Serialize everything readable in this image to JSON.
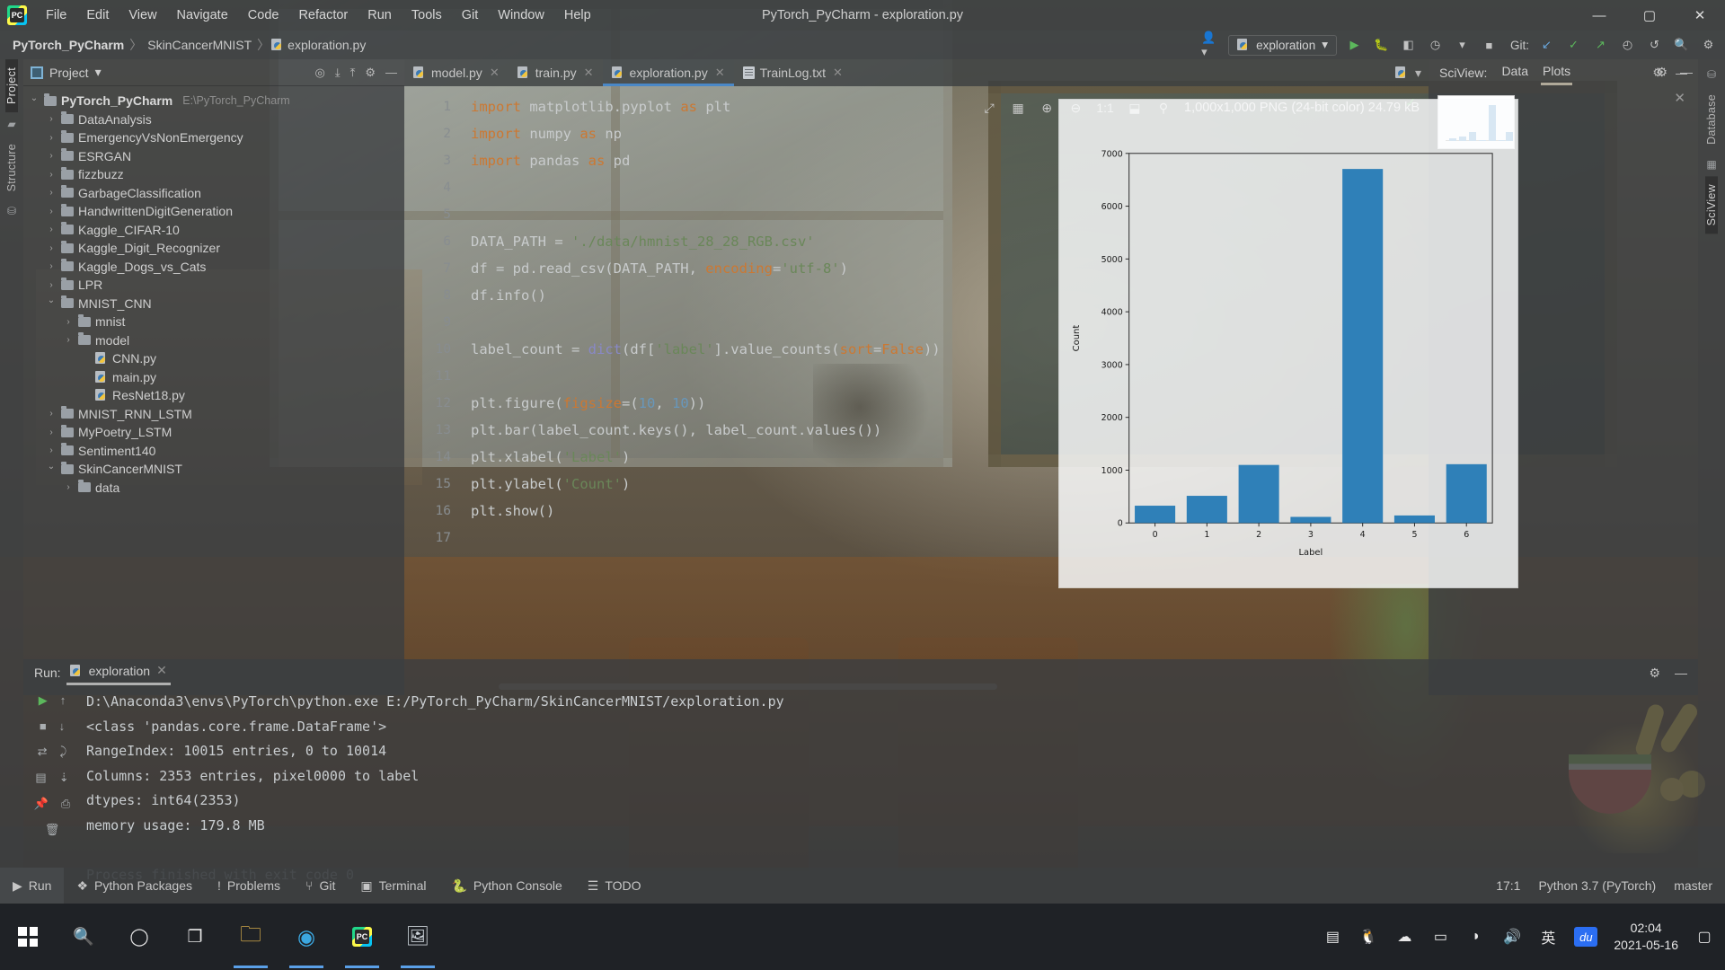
{
  "window": {
    "title": "PyTorch_PyCharm - exploration.py"
  },
  "menubar": {
    "items": [
      "File",
      "Edit",
      "View",
      "Navigate",
      "Code",
      "Refactor",
      "Run",
      "Tools",
      "Git",
      "Window",
      "Help"
    ]
  },
  "window_controls": {
    "minimize": "—",
    "maximize": "▢",
    "close": "✕"
  },
  "breadcrumb": {
    "project": "PyTorch_PyCharm",
    "folder": "SkinCancerMNIST",
    "file": "exploration.py",
    "separator": "〉"
  },
  "toolbar": {
    "run_config": "exploration",
    "git_label": "Git:",
    "icons": [
      "run",
      "debug",
      "coverage",
      "profile",
      "stop",
      "git-update",
      "git-commit",
      "git-push",
      "git-history",
      "undo",
      "search",
      "settings"
    ]
  },
  "left_strip": {
    "tabs": [
      "Project",
      "Structure"
    ],
    "active": "Project"
  },
  "project_panel": {
    "title": "Project",
    "tree": [
      {
        "label": "PyTorch_PyCharm",
        "path": "E:\\PyTorch_PyCharm",
        "type": "root",
        "state": "open",
        "indent": 0
      },
      {
        "label": "DataAnalysis",
        "type": "folder",
        "state": "closed",
        "indent": 1
      },
      {
        "label": "EmergencyVsNonEmergency",
        "type": "folder",
        "state": "closed",
        "indent": 1
      },
      {
        "label": "ESRGAN",
        "type": "folder",
        "state": "closed",
        "indent": 1
      },
      {
        "label": "fizzbuzz",
        "type": "folder",
        "state": "closed",
        "indent": 1
      },
      {
        "label": "GarbageClassification",
        "type": "folder",
        "state": "closed",
        "indent": 1
      },
      {
        "label": "HandwrittenDigitGeneration",
        "type": "folder",
        "state": "closed",
        "indent": 1
      },
      {
        "label": "Kaggle_CIFAR-10",
        "type": "folder",
        "state": "closed",
        "indent": 1
      },
      {
        "label": "Kaggle_Digit_Recognizer",
        "type": "folder",
        "state": "closed",
        "indent": 1
      },
      {
        "label": "Kaggle_Dogs_vs_Cats",
        "type": "folder",
        "state": "closed",
        "indent": 1
      },
      {
        "label": "LPR",
        "type": "folder",
        "state": "closed",
        "indent": 1
      },
      {
        "label": "MNIST_CNN",
        "type": "folder",
        "state": "open",
        "indent": 1
      },
      {
        "label": "mnist",
        "type": "folder",
        "state": "closed",
        "indent": 2
      },
      {
        "label": "model",
        "type": "folder",
        "state": "closed",
        "indent": 2
      },
      {
        "label": "CNN.py",
        "type": "python",
        "state": "none",
        "indent": 3
      },
      {
        "label": "main.py",
        "type": "python",
        "state": "none",
        "indent": 3
      },
      {
        "label": "ResNet18.py",
        "type": "python",
        "state": "none",
        "indent": 3
      },
      {
        "label": "MNIST_RNN_LSTM",
        "type": "folder",
        "state": "closed",
        "indent": 1
      },
      {
        "label": "MyPoetry_LSTM",
        "type": "folder",
        "state": "closed",
        "indent": 1
      },
      {
        "label": "Sentiment140",
        "type": "folder",
        "state": "closed",
        "indent": 1
      },
      {
        "label": "SkinCancerMNIST",
        "type": "folder",
        "state": "open",
        "indent": 1
      },
      {
        "label": "data",
        "type": "folder",
        "state": "closed",
        "indent": 2
      }
    ]
  },
  "editor": {
    "tabs": [
      {
        "label": "model.py",
        "icon": "python-file-icon",
        "active": false
      },
      {
        "label": "train.py",
        "icon": "python-file-icon",
        "active": false
      },
      {
        "label": "exploration.py",
        "icon": "python-file-icon",
        "active": true
      },
      {
        "label": "TrainLog.txt",
        "icon": "text-file-icon",
        "active": false
      }
    ],
    "line_numbers": [
      "1",
      "2",
      "3",
      "4",
      "5",
      "6",
      "7",
      "8",
      "9",
      "10",
      "11",
      "12",
      "13",
      "14",
      "15",
      "16",
      "17"
    ],
    "lines": [
      "import matplotlib.pyplot as plt",
      "import numpy as np",
      "import pandas as pd",
      "",
      "",
      "DATA_PATH = './data/hmnist_28_28_RGB.csv'",
      "df = pd.read_csv(DATA_PATH, encoding='utf-8')",
      "df.info()",
      "",
      "label_count = dict(df['label'].value_counts(sort=False))",
      "",
      "plt.figure(figsize=(10, 10))",
      "plt.bar(label_count.keys(), label_count.values())",
      "plt.xlabel('Label')",
      "plt.ylabel('Count')",
      "plt.show()",
      ""
    ],
    "inspection_status": "✓"
  },
  "sciview": {
    "label": "SciView:",
    "tabs": [
      "Data",
      "Plots"
    ],
    "active_tab": "Plots",
    "image_info": "1,000x1,000 PNG (24-bit color) 24.79 kB",
    "zoom_label": "1:1",
    "toolbar_icons": [
      "fit-icon",
      "grid-icon",
      "zoom-in-icon",
      "zoom-out-icon",
      "actual-size-icon",
      "export-icon",
      "color-picker-icon"
    ]
  },
  "chart_data": {
    "type": "bar",
    "title": "",
    "categories": [
      "0",
      "1",
      "2",
      "3",
      "4",
      "5",
      "6"
    ],
    "values": [
      327,
      514,
      1099,
      115,
      6705,
      142,
      1113
    ],
    "xlabel": "Label",
    "ylabel": "Count",
    "ylim": [
      0,
      7000
    ],
    "yticks": [
      0,
      1000,
      2000,
      3000,
      4000,
      5000,
      6000,
      7000
    ],
    "bar_color": "#1f77b4",
    "grid": false,
    "legend": "none"
  },
  "run_panel": {
    "label": "Run:",
    "tab": "exploration",
    "console_lines": [
      "D:\\Anaconda3\\envs\\PyTorch\\python.exe E:/PyTorch_PyCharm/SkinCancerMNIST/exploration.py",
      "<class 'pandas.core.frame.DataFrame'>",
      "RangeIndex: 10015 entries, 0 to 10014",
      "Columns: 2353 entries, pixel0000 to label",
      "dtypes: int64(2353)",
      "memory usage: 179.8 MB",
      "",
      "Process finished with exit code 0"
    ]
  },
  "right_strip": {
    "tabs": [
      "Database",
      "SciView"
    ],
    "active": "SciView"
  },
  "statusbar": {
    "items": [
      {
        "label": "Run",
        "icon": "run-icon",
        "active": true
      },
      {
        "label": "Python Packages",
        "icon": "packages-icon",
        "active": false
      },
      {
        "label": "Problems",
        "icon": "problems-icon",
        "active": false
      },
      {
        "label": "Git",
        "icon": "git-icon",
        "active": false
      },
      {
        "label": "Terminal",
        "icon": "terminal-icon",
        "active": false
      },
      {
        "label": "Python Console",
        "icon": "python-console-icon",
        "active": false
      },
      {
        "label": "TODO",
        "icon": "todo-icon",
        "active": false
      }
    ],
    "caret_position": "17:1",
    "interpreter": "Python 3.7 (PyTorch)",
    "branch": "master"
  },
  "taskbar": {
    "apps": [
      "start-button",
      "search-icon",
      "cortana-icon",
      "task-view-icon",
      "file-explorer-icon",
      "edge-icon",
      "pycharm-icon",
      "sciview-icon"
    ],
    "tray": [
      "ime-keyboard-icon",
      "qq-icon",
      "onedrive-icon",
      "battery-icon",
      "wifi-icon",
      "volume-icon"
    ],
    "ime_label": "英",
    "baidu_label": "du",
    "clock_time": "02:04",
    "clock_date": "2021-05-16",
    "notification_icon": "notification-icon"
  },
  "colors": {
    "accent": "#4a88c7",
    "bar": "#1f77b4",
    "keyword": "#cc7832",
    "string": "#6a8759",
    "number": "#6897bb"
  }
}
